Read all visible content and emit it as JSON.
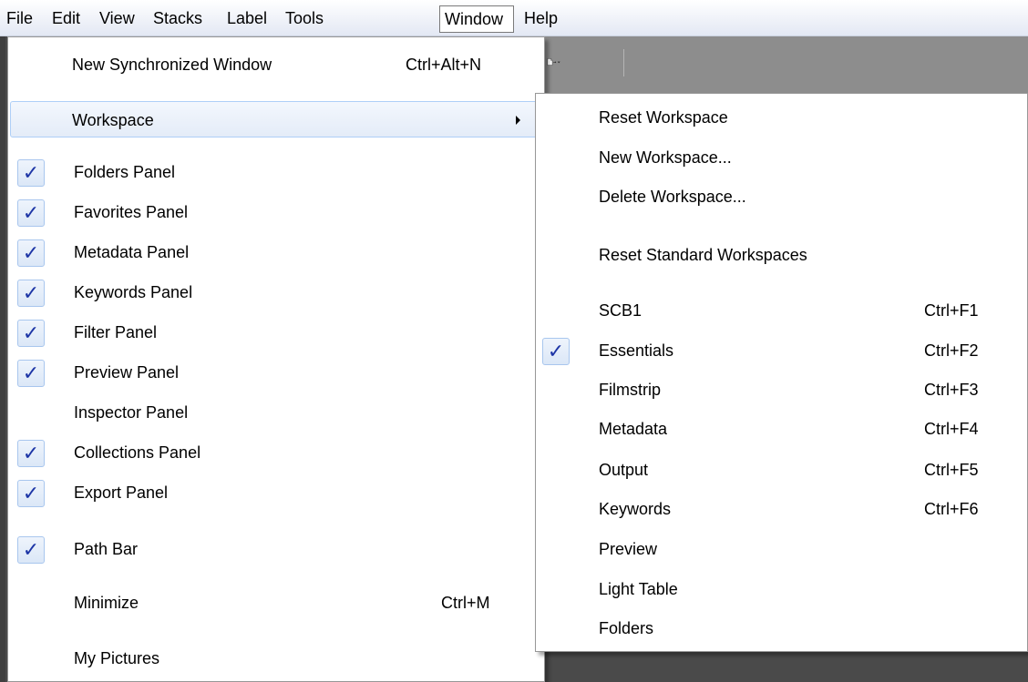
{
  "menubar": {
    "items": [
      {
        "label": "File"
      },
      {
        "label": "Edit"
      },
      {
        "label": "View"
      },
      {
        "label": "Stacks"
      },
      {
        "label": "Label"
      },
      {
        "label": "Tools"
      },
      {
        "label": "Window",
        "active": true
      },
      {
        "label": "Help"
      }
    ]
  },
  "toolbar": {
    "icons": [
      "new-document-icon",
      "arrow-right-icon",
      "dropdown-caret-icon"
    ]
  },
  "window_menu": {
    "items": {
      "new_sync_window": {
        "label": "New Synchronized Window",
        "shortcut": "Ctrl+Alt+N"
      },
      "workspace": {
        "label": "Workspace",
        "submenu": true
      },
      "folders_panel": {
        "label": "Folders Panel",
        "checked": true
      },
      "favorites_panel": {
        "label": "Favorites Panel",
        "checked": true
      },
      "metadata_panel": {
        "label": "Metadata Panel",
        "checked": true
      },
      "keywords_panel": {
        "label": "Keywords Panel",
        "checked": true
      },
      "filter_panel": {
        "label": "Filter Panel",
        "checked": true
      },
      "preview_panel": {
        "label": "Preview Panel",
        "checked": true
      },
      "inspector_panel": {
        "label": "Inspector Panel",
        "checked": false
      },
      "collections_panel": {
        "label": "Collections Panel",
        "checked": true
      },
      "export_panel": {
        "label": "Export Panel",
        "checked": true
      },
      "path_bar": {
        "label": "Path Bar",
        "checked": true
      },
      "minimize": {
        "label": "Minimize",
        "shortcut": "Ctrl+M"
      },
      "my_pictures": {
        "label": "My Pictures"
      }
    },
    "check_glyph": "✓"
  },
  "workspace_submenu": {
    "items": {
      "reset_workspace": {
        "label": "Reset Workspace"
      },
      "new_workspace": {
        "label": "New Workspace..."
      },
      "delete_workspace": {
        "label": "Delete Workspace..."
      },
      "reset_standard": {
        "label": "Reset Standard Workspaces"
      },
      "scb1": {
        "label": "SCB1",
        "shortcut": "Ctrl+F1"
      },
      "essentials": {
        "label": "Essentials",
        "shortcut": "Ctrl+F2",
        "checked": true
      },
      "filmstrip": {
        "label": "Filmstrip",
        "shortcut": "Ctrl+F3"
      },
      "metadata": {
        "label": "Metadata",
        "shortcut": "Ctrl+F4"
      },
      "output": {
        "label": "Output",
        "shortcut": "Ctrl+F5"
      },
      "keywords": {
        "label": "Keywords",
        "shortcut": "Ctrl+F6"
      },
      "preview": {
        "label": "Preview"
      },
      "light_table": {
        "label": "Light Table"
      },
      "folders": {
        "label": "Folders"
      }
    },
    "check_glyph": "✓"
  },
  "colors": {
    "check": "#1d35a6",
    "highlight_border": "#aecff7",
    "menubar_active_border": "#7a7a7a",
    "toolbar_bg": "#8d8d8d"
  }
}
